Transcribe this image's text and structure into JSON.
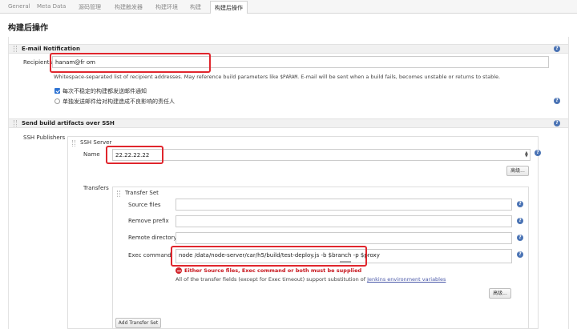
{
  "tabs": [
    {
      "label": "General"
    },
    {
      "label": "Meta Data"
    },
    {
      "label": "源码管理"
    },
    {
      "label": "构建触发器"
    },
    {
      "label": "构建环境"
    },
    {
      "label": "构建"
    },
    {
      "label": "构建后操作",
      "active": true
    }
  ],
  "page_title": "构建后操作",
  "email": {
    "section_title": "E-mail Notification",
    "recipients_label": "Recipients",
    "recipients_value": "hanam@fr                                    om",
    "hint_before": "Whitespace-separated list of recipient addresses. May reference build parameters like ",
    "hint_code": "$PARAM",
    "hint_after": ". E-mail will be sent when a build fails, becomes unstable or returns to stable.",
    "checkbox_every_unstable": {
      "label": "每次不稳定的构建都发送邮件通知",
      "checked": true
    },
    "checkbox_individuals": {
      "label": "单独发送邮件给对构建造成不良影响的责任人",
      "checked": false
    }
  },
  "ssh": {
    "section_title": "Send build artifacts over SSH",
    "publishers_label": "SSH Publishers",
    "server_title": "SSH Server",
    "name_label": "Name",
    "name_value": "22.22.22.22",
    "advanced_label": "高级...",
    "transfers_label": "Transfers",
    "transfer_set_title": "Transfer Set",
    "source_files_label": "Source files",
    "source_files_value": "",
    "remove_prefix_label": "Remove prefix",
    "remove_prefix_value": "",
    "remote_directory_label": "Remote directory",
    "remote_directory_value": "",
    "exec_command_label": "Exec command",
    "exec_command_value": "node /data/node-server/car/h5/build/test-deploy.js -b $branch -p $proxy",
    "error_text": "Either Source files, Exec command or both must be supplied",
    "transfer_hint_text": "All of the transfer fields (except for Exec timeout) support substitution of ",
    "transfer_hint_link": "Jenkins environment variables",
    "transfer_advanced_label": "高级...",
    "add_transfer_set_label": "Add Transfer Set"
  },
  "colors": {
    "highlight_border": "#e0262d",
    "error_text": "#c7161d",
    "help_icon": "#4a73b4",
    "checkbox_checked": "#2d72d2"
  }
}
